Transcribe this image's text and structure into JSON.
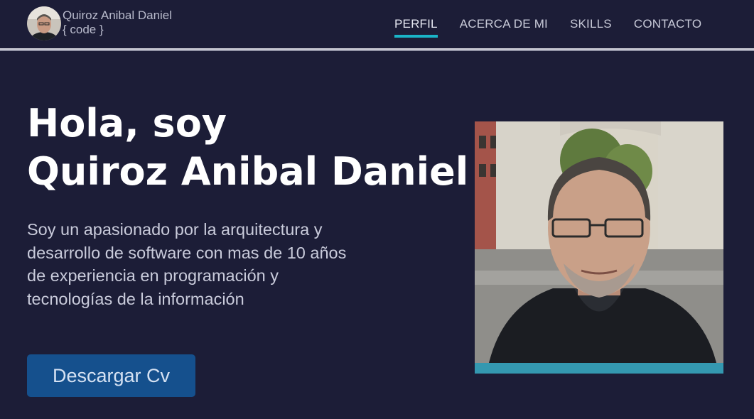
{
  "brand": {
    "name": "Quiroz Anibal Daniel",
    "tagline": "{ code }",
    "avatar_icon": "avatar-photo"
  },
  "nav": {
    "items": [
      {
        "label": "PERFIL",
        "active": true
      },
      {
        "label": "ACERCA DE MI",
        "active": false
      },
      {
        "label": "SKILLS",
        "active": false
      },
      {
        "label": "CONTACTO",
        "active": false
      }
    ]
  },
  "hero": {
    "greeting": "Hola, soy",
    "name": "Quiroz Anibal Daniel",
    "description": "Soy un apasionado por la arquitectura y desarrollo de software con mas de 10 años de experiencia en programación y tecnologías de la información",
    "cv_button_label": "Descargar Cv"
  },
  "colors": {
    "background": "#1c1d37",
    "accent": "#1ab4c7",
    "button": "#15508d",
    "photo_bar": "#3498b0"
  }
}
